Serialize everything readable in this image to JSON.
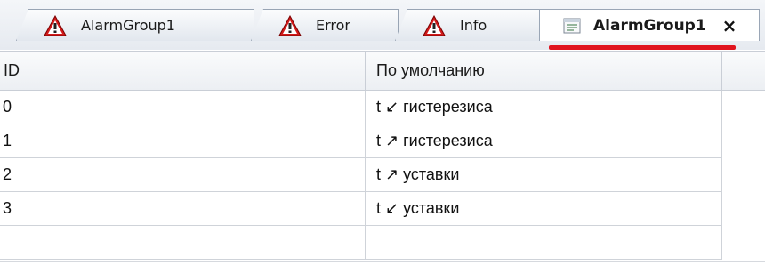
{
  "tabs": [
    {
      "label": "AlarmGroup1",
      "icon": "alarm-triangle-icon",
      "active": false
    },
    {
      "label": "Error",
      "icon": "alarm-triangle-icon",
      "active": false
    },
    {
      "label": "Info",
      "icon": "alarm-triangle-icon",
      "active": false
    },
    {
      "label": "AlarmGroup1",
      "icon": "document-icon",
      "active": true,
      "close": "×"
    }
  ],
  "colors": {
    "accent_underline": "#e0141e",
    "alarm_red": "#d21a1a"
  },
  "table": {
    "columns": [
      "ID",
      "По умолчанию"
    ],
    "rows": [
      {
        "id": "0",
        "default": "t ↙ гистерезиса"
      },
      {
        "id": "1",
        "default": "t ↗ гистерезиса"
      },
      {
        "id": "2",
        "default": "t ↗ уставки"
      },
      {
        "id": "3",
        "default": "t ↙ уставки"
      },
      {
        "id": "",
        "default": ""
      }
    ]
  }
}
